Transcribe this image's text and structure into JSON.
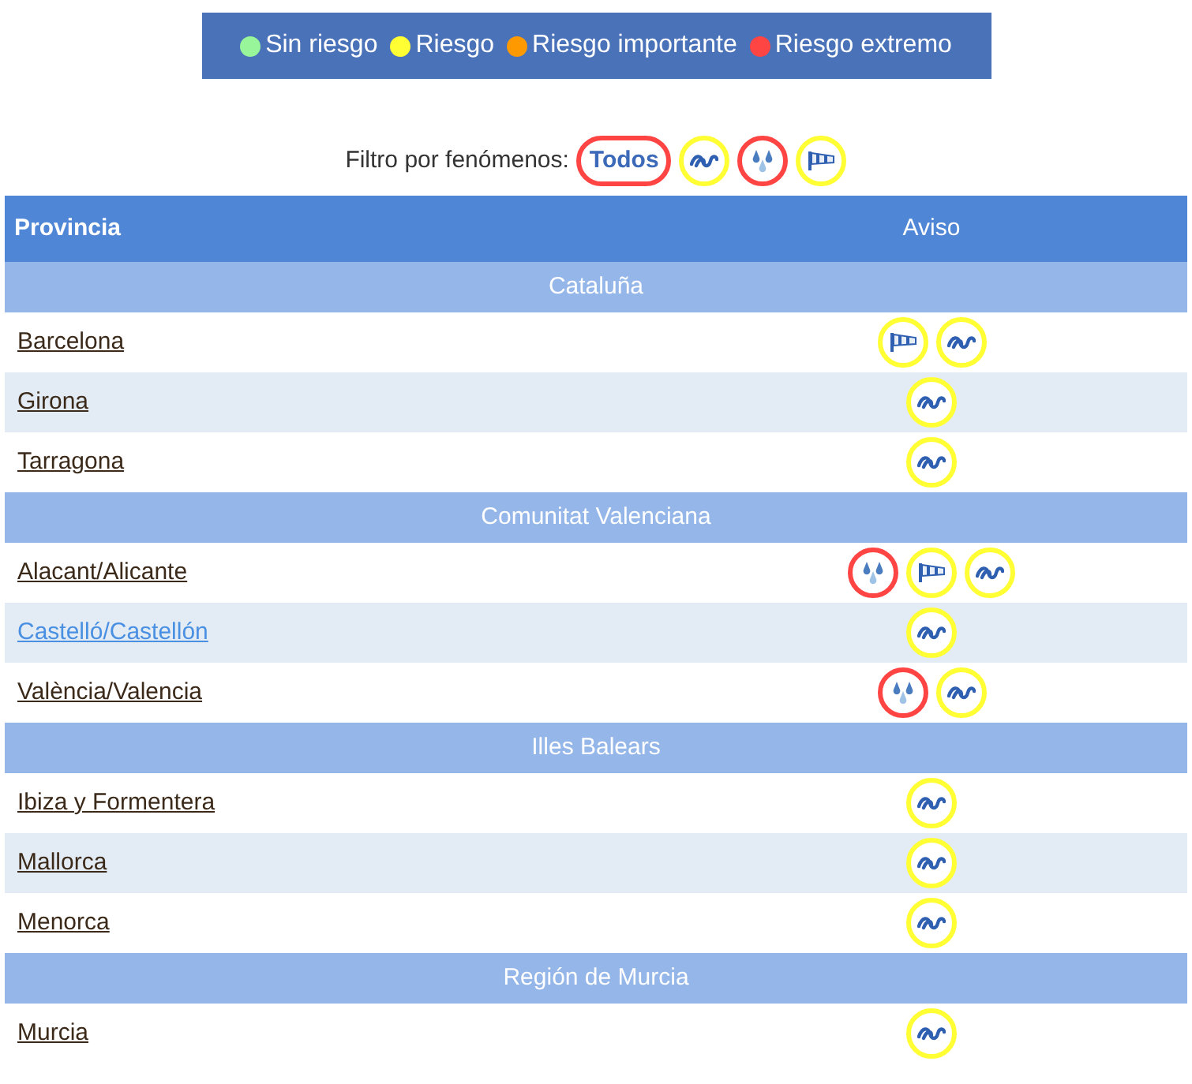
{
  "legend": [
    {
      "label": "Sin riesgo",
      "color": "#99f599"
    },
    {
      "label": "Riesgo",
      "color": "#ffff33"
    },
    {
      "label": "Riesgo importante",
      "color": "#ff9900"
    },
    {
      "label": "Riesgo extremo",
      "color": "#ff4444"
    }
  ],
  "filter": {
    "label": "Filtro por fenómenos:",
    "items": [
      {
        "kind": "text",
        "label": "Todos",
        "color": "#ff4444"
      },
      {
        "kind": "coastal",
        "color": "#ffff33"
      },
      {
        "kind": "rain",
        "color": "#ff4444"
      },
      {
        "kind": "wind",
        "color": "#ffff33"
      }
    ]
  },
  "table": {
    "columns": [
      "Provincia",
      "Aviso"
    ],
    "rows": [
      {
        "kind": "group",
        "label": "Cataluña"
      },
      {
        "kind": "province",
        "name": "Barcelona",
        "hovered": false,
        "warnings": [
          {
            "kind": "wind",
            "color": "#ffff33"
          },
          {
            "kind": "coastal",
            "color": "#ffff33"
          }
        ]
      },
      {
        "kind": "province",
        "name": "Girona",
        "hovered": false,
        "warnings": [
          {
            "kind": "coastal",
            "color": "#ffff33"
          }
        ]
      },
      {
        "kind": "province",
        "name": "Tarragona",
        "hovered": false,
        "warnings": [
          {
            "kind": "coastal",
            "color": "#ffff33"
          }
        ]
      },
      {
        "kind": "group",
        "label": "Comunitat Valenciana"
      },
      {
        "kind": "province",
        "name": "Alacant/Alicante",
        "hovered": false,
        "warnings": [
          {
            "kind": "rain",
            "color": "#ff4444"
          },
          {
            "kind": "wind",
            "color": "#ffff33"
          },
          {
            "kind": "coastal",
            "color": "#ffff33"
          }
        ]
      },
      {
        "kind": "province",
        "name": "Castelló/Castellón",
        "hovered": true,
        "warnings": [
          {
            "kind": "coastal",
            "color": "#ffff33"
          }
        ]
      },
      {
        "kind": "province",
        "name": "València/Valencia",
        "hovered": false,
        "warnings": [
          {
            "kind": "rain",
            "color": "#ff4444"
          },
          {
            "kind": "coastal",
            "color": "#ffff33"
          }
        ]
      },
      {
        "kind": "group",
        "label": "Illes Balears"
      },
      {
        "kind": "province",
        "name": "Ibiza y Formentera",
        "hovered": false,
        "warnings": [
          {
            "kind": "coastal",
            "color": "#ffff33"
          }
        ]
      },
      {
        "kind": "province",
        "name": "Mallorca",
        "hovered": false,
        "warnings": [
          {
            "kind": "coastal",
            "color": "#ffff33"
          }
        ]
      },
      {
        "kind": "province",
        "name": "Menorca",
        "hovered": false,
        "warnings": [
          {
            "kind": "coastal",
            "color": "#ffff33"
          }
        ]
      },
      {
        "kind": "group",
        "label": "Región de Murcia"
      },
      {
        "kind": "province",
        "name": "Murcia",
        "hovered": false,
        "warnings": [
          {
            "kind": "coastal",
            "color": "#ffff33"
          }
        ]
      }
    ]
  }
}
